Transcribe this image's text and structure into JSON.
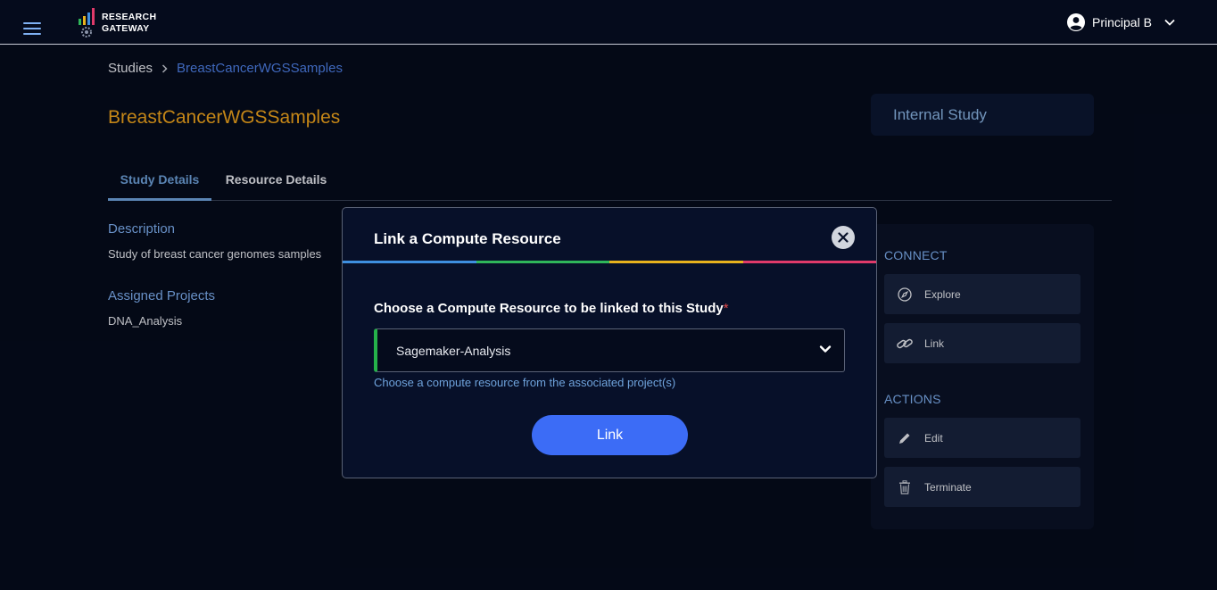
{
  "header": {
    "brand_line1": "RESEARCH",
    "brand_line2": "GATEWAY",
    "menu_icon": "hamburger-icon",
    "user_icon": "account-circle-icon",
    "user_name": "Principal B"
  },
  "breadcrumb": {
    "root": "Studies",
    "current": "BreastCancerWGSSamples"
  },
  "study": {
    "title": "BreastCancerWGSSamples",
    "type_label": "Internal Study"
  },
  "tabs": [
    {
      "label": "Study Details",
      "active": true
    },
    {
      "label": "Resource Details",
      "active": false
    }
  ],
  "details": {
    "description_label": "Description",
    "description_value": "Study of breast cancer genomes samples",
    "projects_label": "Assigned Projects",
    "projects_value": "DNA_Analysis"
  },
  "panel": {
    "connect_heading": "CONNECT",
    "actions_heading": "ACTIONS",
    "buttons": [
      {
        "label": "Explore",
        "icon": "compass-icon"
      },
      {
        "label": "Link",
        "icon": "link-icon"
      },
      {
        "label": "Edit",
        "icon": "pencil-icon"
      },
      {
        "label": "Terminate",
        "icon": "trash-icon"
      }
    ]
  },
  "modal": {
    "title": "Link a Compute Resource",
    "field_label": "Choose a Compute Resource to be linked to this Study",
    "required_mark": "*",
    "selected_value": "Sagemaker-Analysis",
    "help_text": "Choose a compute resource from the associated project(s)",
    "submit_label": "Link"
  },
  "colors": {
    "background": "#050b1c",
    "accent_blue": "#3c6cf6",
    "title_orange": "#f0a41d",
    "rainbow": [
      "#3e8fe0",
      "#2fb65a",
      "#e7b21d",
      "#e03a6a"
    ]
  }
}
